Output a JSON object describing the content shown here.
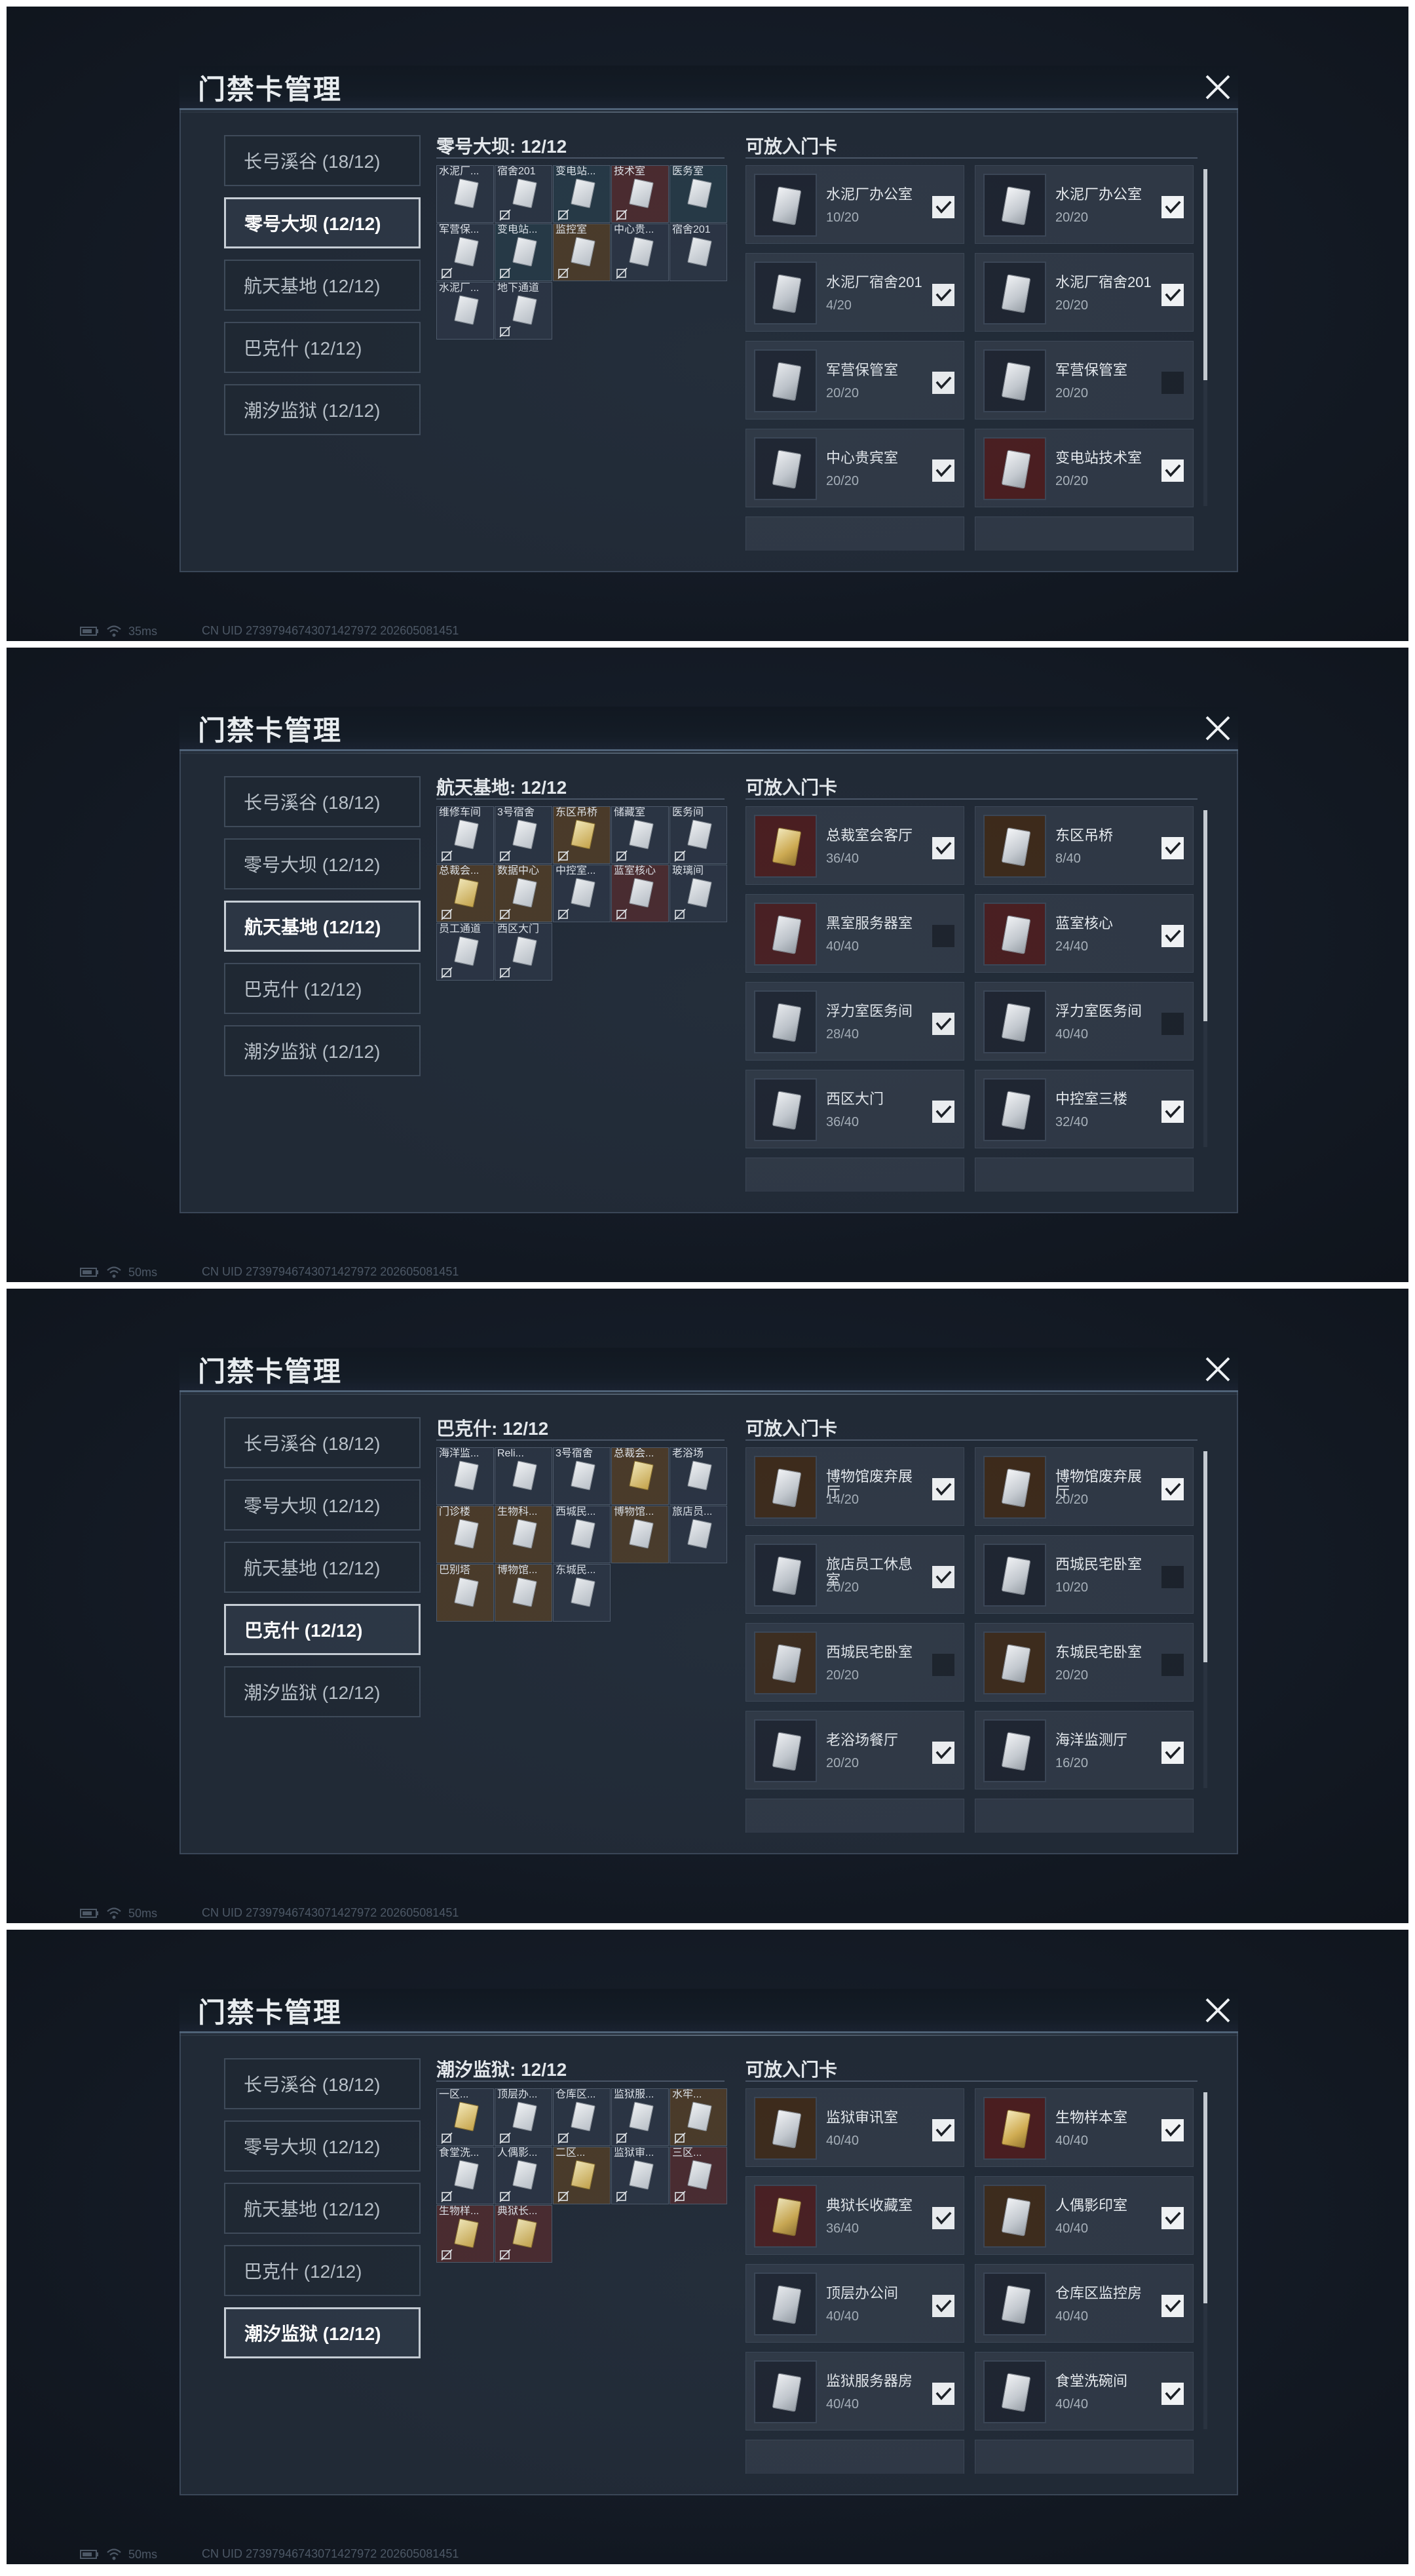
{
  "app": {
    "title": "门禁卡管理",
    "accent": "#c7ced6"
  },
  "tabs_all": [
    "长弓溪谷 (18/12)",
    "零号大坝 (12/12)",
    "航天基地 (12/12)",
    "巴克什 (12/12)",
    "潮汐监狱 (12/12)"
  ],
  "common": {
    "right_title": "可放入门卡",
    "uid": "CN UID 27397946743071427972 202605081451"
  },
  "screens": [
    {
      "active_tab": 1,
      "ping": "35ms",
      "left_title": "零号大坝: 12/12",
      "grid": [
        {
          "label": "水泥厂...",
          "color": "grey",
          "card": "white"
        },
        {
          "label": "宿舍201",
          "color": "grey",
          "card": "white",
          "noicon": true
        },
        {
          "label": "变电站...",
          "color": "teal",
          "card": "white",
          "noicon": true
        },
        {
          "label": "技术室",
          "color": "red",
          "card": "white",
          "noicon": true
        },
        {
          "label": "医务室",
          "color": "teal",
          "card": "white"
        },
        {
          "label": "军营保...",
          "color": "grey",
          "card": "white",
          "noicon": true
        },
        {
          "label": "变电站...",
          "color": "teal",
          "card": "white",
          "noicon": true
        },
        {
          "label": "监控室",
          "color": "gold",
          "card": "white",
          "noicon": true
        },
        {
          "label": "中心贵...",
          "color": "grey",
          "card": "white",
          "noicon": true
        },
        {
          "label": "宿舍201",
          "color": "grey",
          "card": "white"
        },
        {
          "label": "水泥厂...",
          "color": "grey",
          "card": "white"
        },
        {
          "label": "地下通道",
          "color": "grey",
          "card": "white",
          "noicon": true
        }
      ],
      "list": [
        {
          "name": "水泥厂办公室",
          "count": "10/20",
          "checked": true,
          "thumb": "dark",
          "card": "white"
        },
        {
          "name": "水泥厂办公室",
          "count": "20/20",
          "checked": true,
          "thumb": "dark",
          "card": "white"
        },
        {
          "name": "水泥厂宿舍201",
          "count": "4/20",
          "checked": true,
          "thumb": "dark",
          "card": "white"
        },
        {
          "name": "水泥厂宿舍201",
          "count": "20/20",
          "checked": true,
          "thumb": "dark",
          "card": "white"
        },
        {
          "name": "军营保管室",
          "count": "20/20",
          "checked": true,
          "thumb": "dark",
          "card": "white"
        },
        {
          "name": "军营保管室",
          "count": "20/20",
          "checked": false,
          "thumb": "dark",
          "card": "white"
        },
        {
          "name": "中心贵宾室",
          "count": "20/20",
          "checked": true,
          "thumb": "dark",
          "card": "white"
        },
        {
          "name": "变电站技术室",
          "count": "20/20",
          "checked": true,
          "thumb": "red",
          "card": "white"
        }
      ]
    },
    {
      "active_tab": 2,
      "ping": "50ms",
      "left_title": "航天基地: 12/12",
      "grid": [
        {
          "label": "维修车间",
          "color": "grey",
          "card": "white",
          "noicon": true
        },
        {
          "label": "3号宿舍",
          "color": "grey",
          "card": "white",
          "noicon": true
        },
        {
          "label": "东区吊桥",
          "color": "gold",
          "card": "gold",
          "noicon": true
        },
        {
          "label": "储藏室",
          "color": "grey",
          "card": "white",
          "noicon": true
        },
        {
          "label": "医务间",
          "color": "grey",
          "card": "white",
          "noicon": true
        },
        {
          "label": "总裁会...",
          "color": "gold",
          "card": "gold",
          "noicon": true
        },
        {
          "label": "数据中心",
          "color": "gold",
          "card": "white",
          "noicon": true
        },
        {
          "label": "中控室...",
          "color": "grey",
          "card": "white",
          "noicon": true
        },
        {
          "label": "蓝室核心",
          "color": "red",
          "card": "white",
          "noicon": true
        },
        {
          "label": "玻璃间",
          "color": "grey",
          "card": "white",
          "noicon": true
        },
        {
          "label": "员工通道",
          "color": "grey",
          "card": "white",
          "noicon": true
        },
        {
          "label": "西区大门",
          "color": "grey",
          "card": "white",
          "noicon": true
        }
      ],
      "list": [
        {
          "name": "总裁室会客厅",
          "count": "36/40",
          "checked": true,
          "thumb": "red",
          "card": "gold"
        },
        {
          "name": "东区吊桥",
          "count": "8/40",
          "checked": true,
          "thumb": "gold",
          "card": "white"
        },
        {
          "name": "黑室服务器室",
          "count": "40/40",
          "checked": false,
          "thumb": "red",
          "card": "white"
        },
        {
          "name": "蓝室核心",
          "count": "24/40",
          "checked": true,
          "thumb": "red",
          "card": "white"
        },
        {
          "name": "浮力室医务间",
          "count": "28/40",
          "checked": true,
          "thumb": "dark",
          "card": "white"
        },
        {
          "name": "浮力室医务间",
          "count": "40/40",
          "checked": false,
          "thumb": "dark",
          "card": "white"
        },
        {
          "name": "西区大门",
          "count": "36/40",
          "checked": true,
          "thumb": "dark",
          "card": "white"
        },
        {
          "name": "中控室三楼",
          "count": "32/40",
          "checked": true,
          "thumb": "dark",
          "card": "white"
        }
      ]
    },
    {
      "active_tab": 3,
      "ping": "50ms",
      "left_title": "巴克什: 12/12",
      "grid": [
        {
          "label": "海洋监...",
          "color": "grey",
          "card": "white"
        },
        {
          "label": "Reli...",
          "color": "grey",
          "card": "white"
        },
        {
          "label": "3号宿舍",
          "color": "grey",
          "card": "white"
        },
        {
          "label": "总裁会...",
          "color": "gold",
          "card": "gold"
        },
        {
          "label": "老浴场",
          "color": "grey",
          "card": "white"
        },
        {
          "label": "门诊楼",
          "color": "gold",
          "card": "white"
        },
        {
          "label": "生物科...",
          "color": "gold",
          "card": "white"
        },
        {
          "label": "西城民...",
          "color": "grey",
          "card": "white"
        },
        {
          "label": "博物馆...",
          "color": "gold",
          "card": "white"
        },
        {
          "label": "旅店员...",
          "color": "grey",
          "card": "white"
        },
        {
          "label": "巴别塔",
          "color": "gold",
          "card": "white"
        },
        {
          "label": "博物馆...",
          "color": "gold",
          "card": "white"
        },
        {
          "label": "东城民...",
          "color": "grey",
          "card": "white"
        }
      ],
      "list": [
        {
          "name": "博物馆废弃展厅",
          "count": "14/20",
          "checked": true,
          "thumb": "gold",
          "card": "white"
        },
        {
          "name": "博物馆废弃展厅",
          "count": "20/20",
          "checked": true,
          "thumb": "gold",
          "card": "white"
        },
        {
          "name": "旅店员工休息室",
          "count": "20/20",
          "checked": true,
          "thumb": "dark",
          "card": "white"
        },
        {
          "name": "西城民宅卧室",
          "count": "10/20",
          "checked": false,
          "thumb": "dark",
          "card": "white"
        },
        {
          "name": "西城民宅卧室",
          "count": "20/20",
          "checked": false,
          "thumb": "gold",
          "card": "white"
        },
        {
          "name": "东城民宅卧室",
          "count": "20/20",
          "checked": false,
          "thumb": "gold",
          "card": "white"
        },
        {
          "name": "老浴场餐厅",
          "count": "20/20",
          "checked": true,
          "thumb": "dark",
          "card": "white"
        },
        {
          "name": "海洋监测厅",
          "count": "16/20",
          "checked": true,
          "thumb": "dark",
          "card": "white"
        }
      ]
    },
    {
      "active_tab": 4,
      "ping": "50ms",
      "left_title": "潮汐监狱: 12/12",
      "grid": [
        {
          "label": "一区...",
          "color": "grey",
          "card": "gold",
          "noicon": true
        },
        {
          "label": "顶层办...",
          "color": "grey",
          "card": "white",
          "noicon": true
        },
        {
          "label": "仓库区...",
          "color": "grey",
          "card": "white",
          "noicon": true
        },
        {
          "label": "监狱服...",
          "color": "grey",
          "card": "white",
          "noicon": true
        },
        {
          "label": "水牢...",
          "color": "gold",
          "card": "white",
          "noicon": true
        },
        {
          "label": "食堂洗...",
          "color": "grey",
          "card": "white",
          "noicon": true
        },
        {
          "label": "人偶影...",
          "color": "grey",
          "card": "white",
          "noicon": true
        },
        {
          "label": "二区...",
          "color": "gold",
          "card": "gold",
          "noicon": true
        },
        {
          "label": "监狱审...",
          "color": "grey",
          "card": "white",
          "noicon": true
        },
        {
          "label": "三区...",
          "color": "red",
          "card": "white",
          "noicon": true
        },
        {
          "label": "生物样...",
          "color": "red",
          "card": "gold",
          "noicon": true
        },
        {
          "label": "典狱长...",
          "color": "red",
          "card": "gold",
          "noicon": true
        }
      ],
      "list": [
        {
          "name": "监狱审讯室",
          "count": "40/40",
          "checked": true,
          "thumb": "gold",
          "card": "white"
        },
        {
          "name": "生物样本室",
          "count": "40/40",
          "checked": true,
          "thumb": "red",
          "card": "gold"
        },
        {
          "name": "典狱长收藏室",
          "count": "36/40",
          "checked": true,
          "thumb": "red",
          "card": "gold"
        },
        {
          "name": "人偶影印室",
          "count": "40/40",
          "checked": true,
          "thumb": "gold",
          "card": "white"
        },
        {
          "name": "顶层办公间",
          "count": "40/40",
          "checked": true,
          "thumb": "dark",
          "card": "white"
        },
        {
          "name": "仓库区监控房",
          "count": "40/40",
          "checked": true,
          "thumb": "dark",
          "card": "white"
        },
        {
          "name": "监狱服务器房",
          "count": "40/40",
          "checked": true,
          "thumb": "dark",
          "card": "white"
        },
        {
          "name": "食堂洗碗间",
          "count": "40/40",
          "checked": true,
          "thumb": "dark",
          "card": "white"
        }
      ]
    }
  ]
}
